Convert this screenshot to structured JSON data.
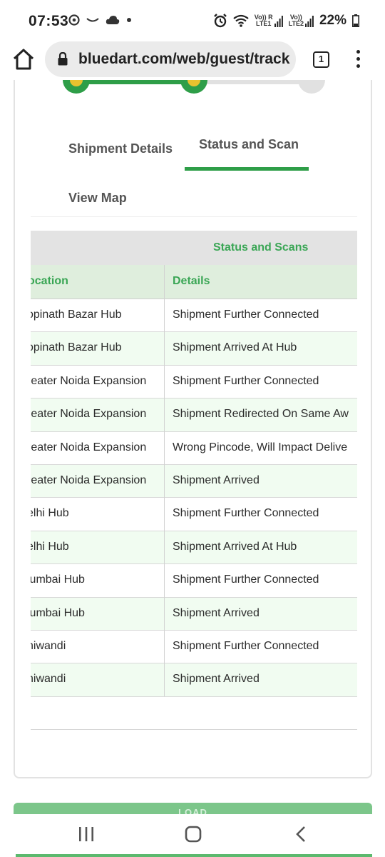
{
  "status_bar": {
    "time": "07:53",
    "battery_percent": "22%",
    "sim1_label": "Vo)) R",
    "sim1_net": "LTE1",
    "sim2_label": "Vo))",
    "sim2_net": "LTE2"
  },
  "browser": {
    "url": "bluedart.com/web/guest/track",
    "tab_count": "1"
  },
  "progress": {
    "completed_steps": 2,
    "total_steps": 3
  },
  "tabs": {
    "shipment_details": "Shipment Details",
    "status_and_scan": "Status and Scan",
    "view_map": "View Map"
  },
  "table": {
    "title": "Status and Scans",
    "headers": {
      "location": "ocation",
      "details": "Details"
    },
    "rows": [
      {
        "location": "opinath Bazar Hub",
        "details": "Shipment Further Connected"
      },
      {
        "location": "opinath Bazar Hub",
        "details": "Shipment Arrived At Hub"
      },
      {
        "location": "reater Noida Expansion",
        "details": "Shipment Further Connected"
      },
      {
        "location": "reater Noida Expansion",
        "details": "Shipment Redirected On Same Aw"
      },
      {
        "location": "reater Noida Expansion",
        "details": "Wrong Pincode, Will Impact Delive"
      },
      {
        "location": "reater Noida Expansion",
        "details": "Shipment Arrived"
      },
      {
        "location": "elhi Hub",
        "details": "Shipment Further Connected"
      },
      {
        "location": "elhi Hub",
        "details": "Shipment Arrived At Hub"
      },
      {
        "location": "lumbai Hub",
        "details": "Shipment Further Connected"
      },
      {
        "location": "lumbai Hub",
        "details": "Shipment Arrived"
      },
      {
        "location": "hiwandi",
        "details": "Shipment Further Connected"
      },
      {
        "location": "hiwandi",
        "details": "Shipment Arrived"
      }
    ]
  },
  "bottom_button": {
    "label": "LOAD"
  },
  "colors": {
    "brand_green": "#2e9e48",
    "header_green_text": "#3aa655",
    "row_alt_bg": "#f1fcf1",
    "progress_dot_inner": "#e8c22f"
  }
}
